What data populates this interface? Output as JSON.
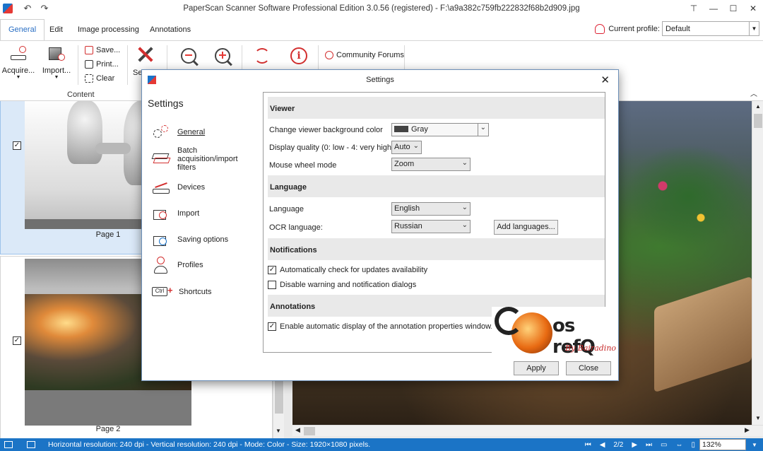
{
  "window": {
    "title": "PaperScan Scanner Software Professional Edition 3.0.56 (registered) - F:\\a9a382c759fb222832f68b2d909.jpg"
  },
  "tabs": [
    "General",
    "Edit",
    "Image processing",
    "Annotations"
  ],
  "profile": {
    "label": "Current profile:",
    "value": "Default"
  },
  "ribbon": {
    "acquire": "Acquire...",
    "import": "Import...",
    "save": "Save...",
    "print": "Print...",
    "clear": "Clear",
    "settings_partial": "Se",
    "community": "Community Forums",
    "group_content": "Content"
  },
  "pages": [
    {
      "label": "Page 1",
      "checked": true
    },
    {
      "label": "Page 2",
      "checked": true
    }
  ],
  "dialog": {
    "title": "Settings",
    "nav_heading": "Settings",
    "nav": [
      {
        "label": "General",
        "icon": "gears-icon"
      },
      {
        "label": "Batch acquisition/import filters",
        "icon": "batch-stack-icon"
      },
      {
        "label": "Devices",
        "icon": "scanner-icon"
      },
      {
        "label": "Import",
        "icon": "import-icon"
      },
      {
        "label": "Saving options",
        "icon": "save-upload-icon"
      },
      {
        "label": "Profiles",
        "icon": "user-icon"
      },
      {
        "label": "Shortcuts",
        "icon": "keyboard-shortcut-icon"
      }
    ],
    "sections": {
      "viewer": "Viewer",
      "language": "Language",
      "notifications": "Notifications",
      "annotations": "Annotations"
    },
    "fields": {
      "bg_color_label": "Change viewer background color",
      "bg_color_value": "Gray",
      "quality_label": "Display quality (0: low - 4: very high)",
      "quality_value": "Auto",
      "wheel_label": "Mouse wheel mode",
      "wheel_value": "Zoom",
      "language_label": "Language",
      "language_value": "English",
      "ocr_label": "OCR language:",
      "ocr_value": "Russian",
      "add_languages": "Add languages..."
    },
    "checks": {
      "auto_update": "Automatically check for updates availability",
      "auto_update_checked": true,
      "disable_warnings": "Disable warning and notification dialogs",
      "disable_warnings_checked": false,
      "annotation_props": "Enable automatic display of the annotation properties window.",
      "annotation_props_checked": true
    },
    "buttons": {
      "apply": "Apply",
      "close": "Close"
    }
  },
  "watermark": {
    "text": "os refQ",
    "by": "By Bairadino"
  },
  "statusbar": {
    "text": "Horizontal resolution:  240 dpi - Vertical resolution:  240 dpi - Mode: Color - Size: 1920×1080 pixels.",
    "page": "2/2",
    "zoom": "132%"
  }
}
